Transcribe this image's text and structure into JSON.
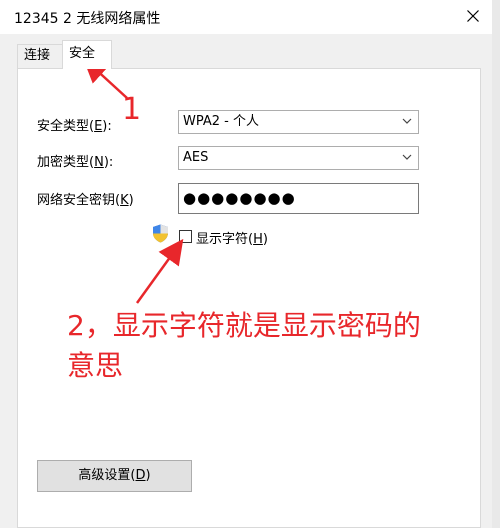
{
  "window": {
    "title": "12345 2 无线网络属性"
  },
  "tabs": [
    {
      "label": "连接"
    },
    {
      "label": "安全"
    }
  ],
  "security": {
    "type_label": "安全类型(",
    "type_key": "E",
    "type_suffix": "):",
    "type_value": "WPA2 - 个人",
    "encryption_label": "加密类型(",
    "encryption_key": "N",
    "encryption_suffix": "):",
    "encryption_value": "AES",
    "key_label": "网络安全密钥(",
    "key_key": "K",
    "key_suffix": ")",
    "key_value": "●●●●●●●●",
    "show_chars_label": "显示字符(",
    "show_chars_key": "H",
    "show_chars_suffix": ")",
    "show_chars_checked": false
  },
  "advanced_button": {
    "label": "高级设置(",
    "key": "D",
    "suffix": ")"
  },
  "annotations": {
    "one": "1",
    "two_line1": "2，显示字符就是显示密码的",
    "two_line2": "意思",
    "color": "#e8272b"
  }
}
